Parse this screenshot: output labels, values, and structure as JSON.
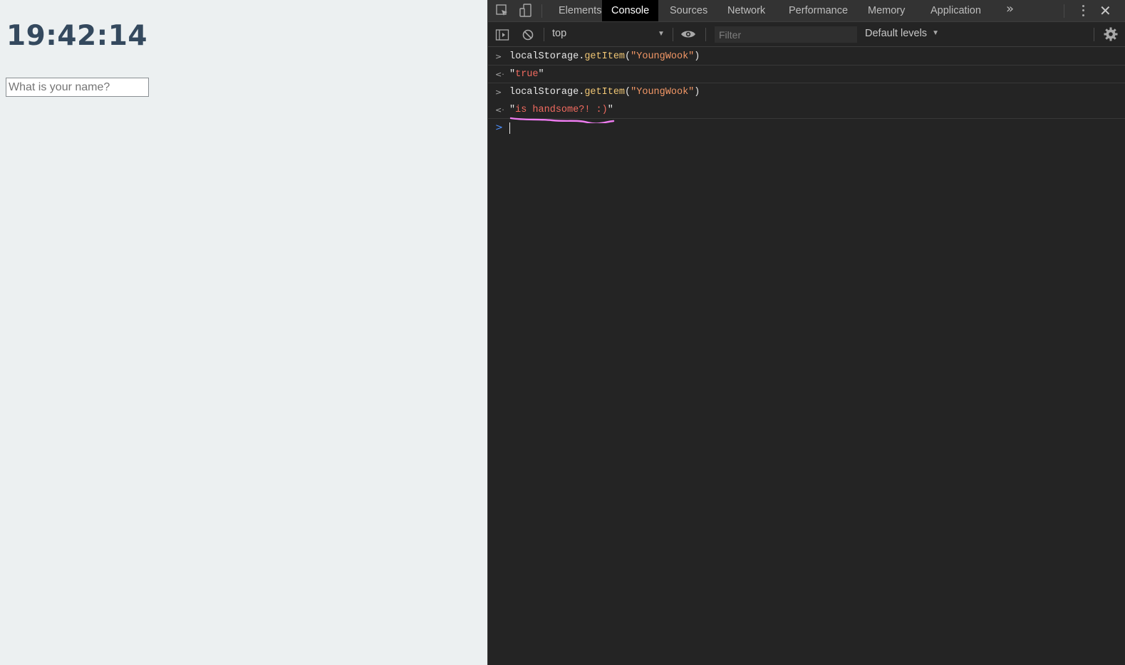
{
  "page": {
    "clock_text": "19:42:14",
    "name_placeholder": "What is your name?"
  },
  "devtools": {
    "tabs": [
      "Elements",
      "Console",
      "Sources",
      "Network",
      "Performance",
      "Memory",
      "Application"
    ],
    "active_tab": "Console",
    "more_tabs_glyph": "»",
    "close_glyph": "✕",
    "toolbar": {
      "context": "top",
      "filter_placeholder": "Filter",
      "levels": "Default levels"
    },
    "console": {
      "entries": [
        {
          "kind": "input",
          "gutter": ">",
          "object": "localStorage",
          "dot": ".",
          "method": "getItem",
          "open": "(",
          "arg": "\"YoungWook\"",
          "close": ")"
        },
        {
          "kind": "result",
          "gutter": "<·",
          "open_quote": "\"",
          "value": "true",
          "close_quote": "\""
        },
        {
          "kind": "input",
          "gutter": ">",
          "object": "localStorage",
          "dot": ".",
          "method": "getItem",
          "open": "(",
          "arg": "\"YoungWook\"",
          "close": ")"
        },
        {
          "kind": "result",
          "gutter": "<·",
          "open_quote": "\"",
          "value": "is handsome?! :)",
          "close_quote": "\""
        }
      ],
      "prompt_glyph": ">"
    },
    "colors": {
      "annotation_underline": "#ee7cf0",
      "string_value": "#f06a5f",
      "prompt": "#4d90fe"
    }
  }
}
